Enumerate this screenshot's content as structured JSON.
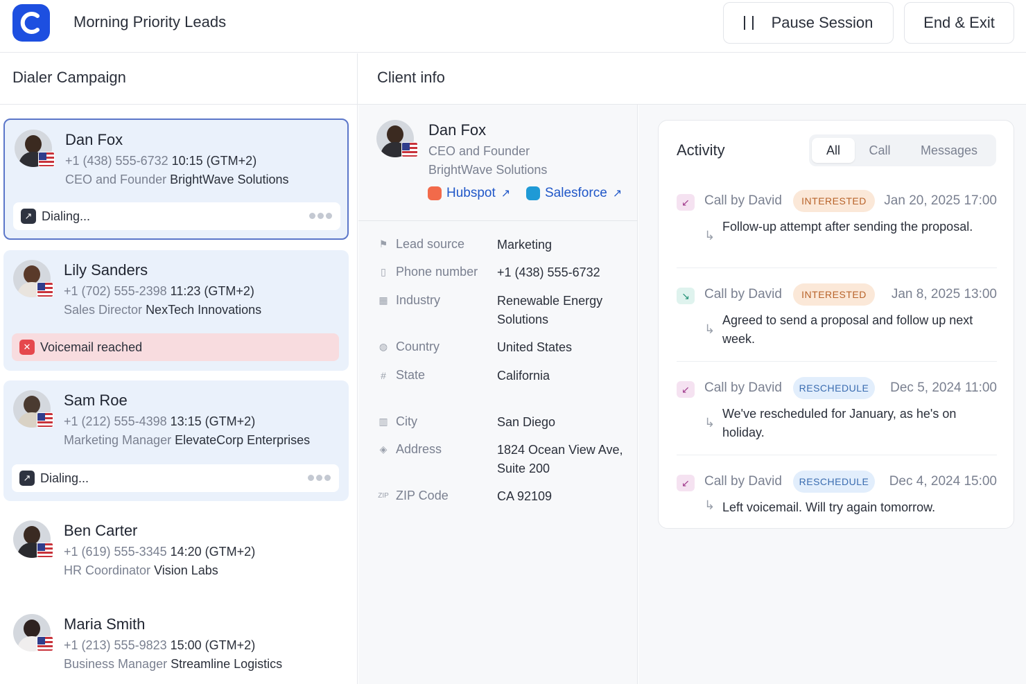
{
  "app": {
    "title": "Morning Priority Leads",
    "pause_label": "Pause Session",
    "exit_label": "End & Exit"
  },
  "campaign": {
    "heading": "Dialer Campaign",
    "contacts": [
      {
        "name": "Dan Fox",
        "phone": "+1 (438) 555-6732",
        "time": "10:15 (GTM+2)",
        "role": "CEO and Founder",
        "company": "BrightWave Solutions",
        "status": "Dialing..."
      },
      {
        "name": "Lily Sanders",
        "phone": "+1 (702) 555-2398",
        "time": "11:23 (GTM+2)",
        "role": "Sales Director",
        "company": "NexTech Innovations",
        "status": "Voicemail reached"
      },
      {
        "name": "Sam Roe",
        "phone": "+1 (212) 555-4398",
        "time": "13:15 (GTM+2)",
        "role": "Marketing Manager",
        "company": "ElevateCorp Enterprises",
        "status": "Dialing..."
      },
      {
        "name": "Ben Carter",
        "phone": "+1 (619) 555-3345",
        "time": "14:20 (GTM+2)",
        "role": "HR Coordinator",
        "company": "Vision Labs"
      },
      {
        "name": "Maria Smith",
        "phone": "+1 (213) 555-9823",
        "time": "15:00 (GTM+2)",
        "role": "Business Manager",
        "company": "Streamline Logistics"
      }
    ]
  },
  "client": {
    "heading": "Client info",
    "name": "Dan Fox",
    "role": "CEO and Founder",
    "company": "BrightWave Solutions",
    "crm": {
      "hubspot": "Hubspot",
      "salesforce": "Salesforce"
    },
    "fields": {
      "lead_source": {
        "label": "Lead source",
        "value": "Marketing"
      },
      "phone": {
        "label": "Phone number",
        "value": "+1 (438) 555-6732"
      },
      "industry": {
        "label": "Industry",
        "value": "Renewable Energy Solutions"
      },
      "country": {
        "label": "Country",
        "value": "United States"
      },
      "state": {
        "label": "State",
        "value": "California"
      },
      "city": {
        "label": "City",
        "value": "San Diego"
      },
      "address": {
        "label": "Address",
        "value": "1824 Ocean View Ave, Suite 200"
      },
      "zip": {
        "label": "ZIP Code",
        "value": "CA 92109",
        "icon_text": "ZIP"
      }
    }
  },
  "activity": {
    "title": "Activity",
    "tabs": [
      "All",
      "Call",
      "Messages"
    ],
    "entries": [
      {
        "by": "Call by David",
        "badge": "INTERESTED",
        "date": "Jan 20, 2025 17:00",
        "note": "Follow-up attempt after sending the proposal."
      },
      {
        "by": "Call by David",
        "badge": "INTERESTED",
        "date": "Jan 8, 2025 13:00",
        "note": "Agreed to send a proposal and follow up next week."
      },
      {
        "by": "Call by David",
        "badge": "RESCHEDULE",
        "date": "Dec 5, 2024 11:00",
        "note": "We've rescheduled for January, as he's on holiday."
      },
      {
        "by": "Call by David",
        "badge": "RESCHEDULE",
        "date": "Dec 4, 2024 15:00",
        "note": "Left voicemail. Will try again tomorrow."
      }
    ]
  },
  "colors": {
    "brand": "#1d4fe0",
    "active_border": "#5b76c9",
    "interested": "#b8632a",
    "reschedule": "#3a6cb0",
    "voicemail": "#e5484d"
  }
}
